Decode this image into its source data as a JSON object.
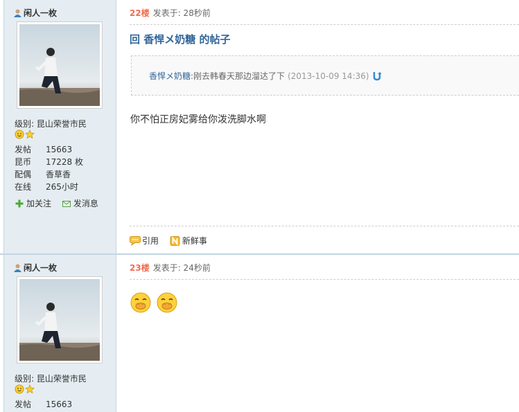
{
  "posts": [
    {
      "author": "闲人一枚",
      "level_label": "级别: 昆山荣誉市民",
      "stats": [
        {
          "key": "发帖",
          "value": "15663"
        },
        {
          "key": "昆币",
          "value": "17228 枚"
        },
        {
          "key": "配偶",
          "value": "香草香"
        },
        {
          "key": "在线",
          "value": "265小时"
        }
      ],
      "actions": {
        "follow": "加关注",
        "message": "发消息"
      },
      "floor": "22楼",
      "posted": "发表于: 28秒前",
      "reply_title": "回 香悍メ奶糖 的帖子",
      "quote": {
        "author": "香悍メ奶糖",
        "text": ":刚去韩春天那边溜达了下",
        "time": "(2013-10-09 14:36)"
      },
      "content": "你不怕正房妃雾给你泼洗脚水啊",
      "tools": {
        "quote": "引用",
        "news": "新鲜事"
      }
    },
    {
      "author": "闲人一枚",
      "level_label": "级别: 昆山荣誉市民",
      "stats": [
        {
          "key": "发帖",
          "value": "15663"
        }
      ],
      "floor": "23楼",
      "posted": "发表于: 24秒前",
      "emojis": [
        "laughing-face",
        "laughing-face"
      ]
    }
  ],
  "colors": {
    "sidebar_bg": "#e5edf2",
    "floor": "#f26c4f",
    "link": "#336699"
  }
}
